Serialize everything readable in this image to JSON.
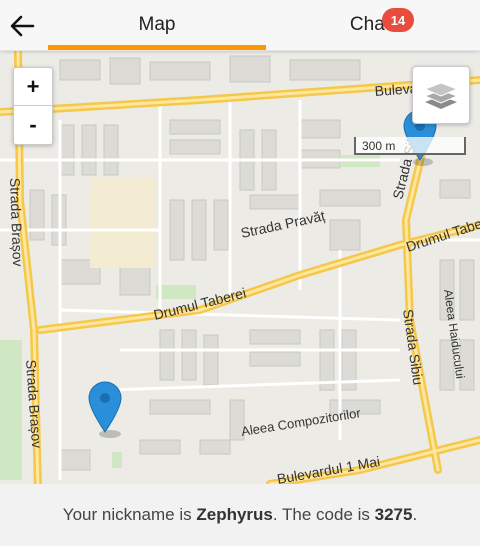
{
  "header": {
    "back_icon": "arrow-left-icon",
    "tabs": [
      {
        "label": "Map",
        "active": true
      },
      {
        "label": "Chat",
        "badge": "14"
      }
    ],
    "accent_color": "#ff9800",
    "badge_color": "#e74c3c"
  },
  "map": {
    "zoom_in": "+",
    "zoom_out": "-",
    "layers_icon": "layers-icon",
    "scale_label": "300 m",
    "streets": [
      "Bulevardul",
      "Strada Brașov",
      "Strada Brașov",
      "Strada Pravăț",
      "Drumul Taberei",
      "Drumul Tabe",
      "Strada Sibiu",
      "Strada Sibiu",
      "Aleea Haiducului",
      "Aleea Compozitorilor",
      "Bulevardul 1 Mai"
    ],
    "markers": [
      "map-marker-icon",
      "map-marker-icon"
    ]
  },
  "footer": {
    "prefix": "Your nickname is ",
    "nickname": "Zephyrus",
    "middle": ". The code is ",
    "code": "3275",
    "suffix": "."
  }
}
